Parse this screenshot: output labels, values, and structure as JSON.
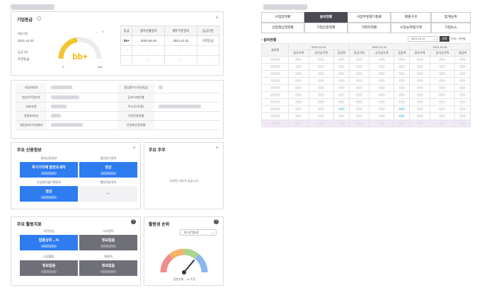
{
  "colors": {
    "accent_blue": "#2e7cf0",
    "gray_box": "#6f6f78",
    "active_tab": "#4a4a52",
    "gauge_yellow": "#f4c430",
    "highlight_row": "#f1e8f7"
  },
  "left": {
    "grade_panel": {
      "title": "기업등급",
      "base_label": "재무기준",
      "base_date": "2021-12-31",
      "grade_type_label": "등급구분",
      "grade_type_value": "또한등급",
      "gauge_value": "bb+",
      "gauge_progress": 0.45,
      "gauge_min": "D",
      "gauge_max": "AAA",
      "gauge_zero": "0",
      "table_headers": [
        "등급",
        "평가산출일자",
        "재무기준일자",
        "등급구분"
      ],
      "table_row": [
        "bb+",
        "2022-06-19",
        "2021-12-31",
        "또한등급"
      ],
      "empty_rows": [
        [
          "-",
          "-",
          "-",
          "-"
        ],
        [
          "-",
          "-",
          "-",
          "-"
        ]
      ]
    },
    "info_panel": {
      "rows": [
        {
          "l1": "사업자번호",
          "l2": "종업원수(국민연금)"
        },
        {
          "l1": "법인(주민)번호",
          "l2": "당좌거래은행"
        },
        {
          "l1": "대표자명",
          "l2": "주소(도로명)"
        },
        {
          "l1": "업종(KSIC)",
          "l2": "기업인증현황"
        },
        {
          "l1": "설립일자/기업형태",
          "l2": "산업재산권현황"
        }
      ]
    },
    "main_info": {
      "title": "주요 신용정보",
      "sub1": "중대신용정보",
      "sub2": "법인등기정보",
      "sub3": "기업채무불이행정보",
      "sub4": "행정처분정보",
      "box1": "투기가치에 말한조세자",
      "box2": "정상",
      "box3": "정상",
      "box4": "–"
    },
    "main_news": {
      "title": "주요 주주",
      "empty": "조회된 자료가 없습니다."
    },
    "activity": {
      "title": "주요 활동지표",
      "sub1": "국민연금",
      "sub2": "나라장터",
      "sub3": "사업활동",
      "sub4": "채용액",
      "box1": "업종상위 ...%",
      "box2": "정보없음",
      "box3": "정보없음",
      "box4": "정보없음"
    },
    "rank": {
      "title": "활동성 순위",
      "select_value": "최근산업분류",
      "caption": "업종상위 ...% 수준",
      "level": 0.72
    }
  },
  "right": {
    "tabs_row1": [
      "사업장현황",
      "설비현황",
      "사업부문별기등률",
      "매출구성",
      "업계순위"
    ],
    "tabs_row2": [
      "산업재산권현황",
      "기업인증현황",
      "거래처현황",
      "시장능력평가액",
      "기업뉴스"
    ],
    "active_tab": "설비현황",
    "section_title": "설비현황",
    "date_select": "2021-12-31",
    "search_button": "조회",
    "unit_label": "(단위 : 백만원)",
    "col_main": "설비종",
    "years": [
      "2019-12-31",
      "2020-12-31",
      "2021-12-31"
    ],
    "subcols": [
      "장부가액",
      "공가상각액",
      "증감액"
    ]
  }
}
